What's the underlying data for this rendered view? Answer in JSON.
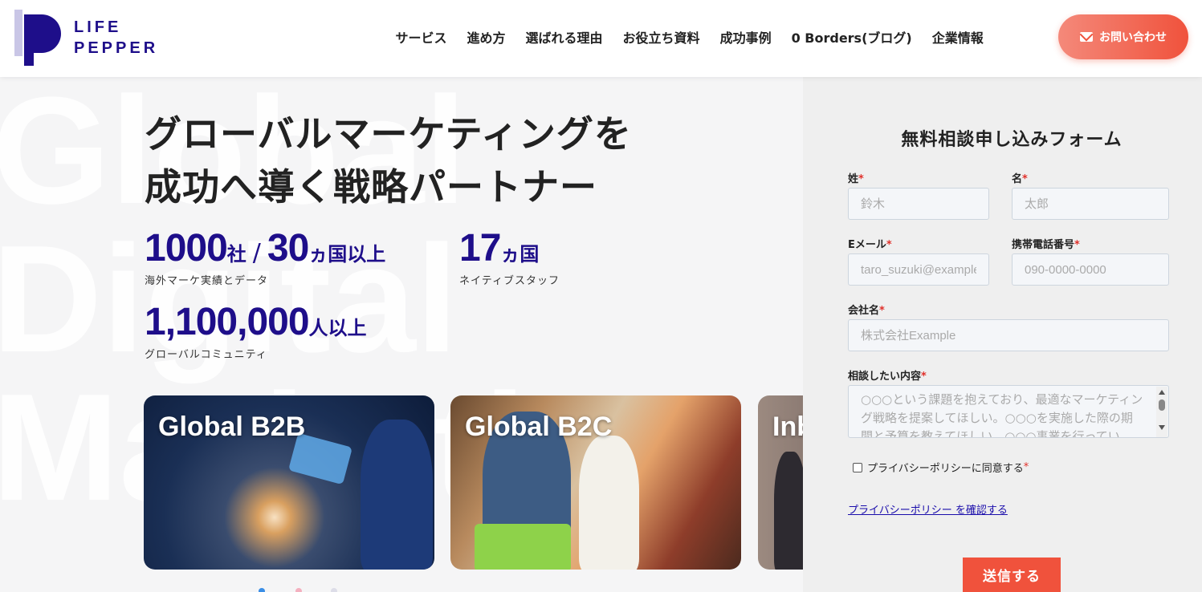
{
  "header": {
    "logo_line1": "LIFE",
    "logo_line2": "PEPPER",
    "nav": [
      "サービス",
      "進め方",
      "選ばれる理由",
      "お役立ち資料",
      "成功事例",
      "0 Borders(ブログ)",
      "企業情報"
    ],
    "cta_label": "お問い合わせ"
  },
  "hero": {
    "watermark_lines": [
      "Global",
      "Digital",
      "Marketing"
    ],
    "headline_line1": "グローバルマーケティングを",
    "headline_line2": "成功へ導く戦略パートナー",
    "stats": {
      "companies_num": "1000",
      "companies_unit": "社",
      "sep": "/",
      "countries_num": "30",
      "countries_unit": "ヵ国以上",
      "caption1": "海外マーケ実績とデータ",
      "native_num": "17",
      "native_unit": "ヵ国",
      "caption2": "ネイティブスタッフ",
      "community_num": "1,100,000",
      "community_unit": "人以上",
      "caption3": "グローバルコミュニティ"
    },
    "cards": [
      "Global B2B",
      "Global B2C",
      "Inb"
    ]
  },
  "form": {
    "title": "無料相談申し込みフォーム",
    "last_name_label": "姓",
    "last_name_placeholder": "鈴木",
    "first_name_label": "名",
    "first_name_placeholder": "太郎",
    "email_label": "Eメール",
    "email_placeholder": "taro_suzuki@example.com",
    "phone_label": "携帯電話番号",
    "phone_placeholder": "090-0000-0000",
    "company_label": "会社名",
    "company_placeholder": "株式会社Example",
    "inquiry_label": "相談したい内容",
    "inquiry_placeholder": "○○○という課題を抱えており、最適なマーケティング戦略を提案してほしい。○○○を実施した際の期間と予算を教えてほしい。○○○事業を行ってい",
    "required_mark": "*",
    "privacy_agree": "プライバシーポリシーに同意する",
    "privacy_link": "プライバシーポリシー を確認する",
    "submit_label": "送信する"
  },
  "colors": {
    "brand_navy": "#1e0e8a",
    "accent_coral": "#f0523c",
    "logo_lavender": "#c9c6e6"
  }
}
